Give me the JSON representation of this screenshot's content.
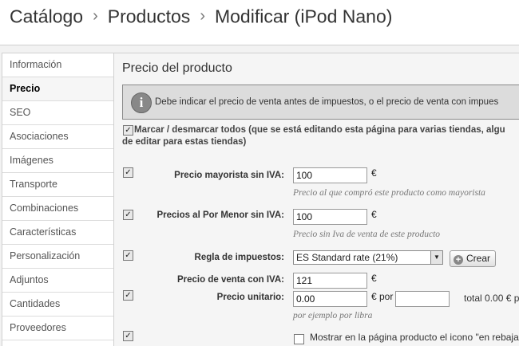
{
  "breadcrumb": [
    "Catálogo",
    "Productos",
    "Modificar (iPod Nano)"
  ],
  "sidebar": {
    "items": [
      {
        "label": "Información"
      },
      {
        "label": "Precio"
      },
      {
        "label": "SEO"
      },
      {
        "label": "Asociaciones"
      },
      {
        "label": "Imágenes"
      },
      {
        "label": "Transporte"
      },
      {
        "label": "Combinaciones"
      },
      {
        "label": "Características"
      },
      {
        "label": "Personalización"
      },
      {
        "label": "Adjuntos"
      },
      {
        "label": "Cantidades"
      },
      {
        "label": "Proveedores"
      }
    ],
    "active_index": 1
  },
  "main": {
    "title": "Precio del producto",
    "info_message": "Debe indicar el precio de venta antes de impuestos, o el precio de venta con impues",
    "mark_all_line1": "Marcar / desmarcar todos (que se está editando esta página para varias tiendas, algu",
    "mark_all_line2": "de editar para estas tiendas)",
    "wholesale": {
      "label": "Precio mayorista sin IVA:",
      "value": "100",
      "suffix": "€",
      "hint": "Precio al que compró este producto como mayorista"
    },
    "retail": {
      "label": "Precios al Por Menor sin IVA:",
      "value": "100",
      "suffix": "€",
      "hint": "Precio sin Iva de venta de este producto"
    },
    "tax_rule": {
      "label": "Regla de impuestos:",
      "value": "ES Standard rate (21%)",
      "create_label": "Crear"
    },
    "final_price": {
      "label": "Precio de venta con IVA:",
      "value": "121",
      "suffix": "€"
    },
    "unit_price": {
      "label": "Precio unitario:",
      "value": "0.00",
      "suffix": "€ por",
      "unit_value": "",
      "total": "total 0.00 € p",
      "hint": "por ejemplo por libra"
    },
    "on_sale": {
      "label": "Mostrar en la página producto el icono \"en rebaja"
    }
  }
}
